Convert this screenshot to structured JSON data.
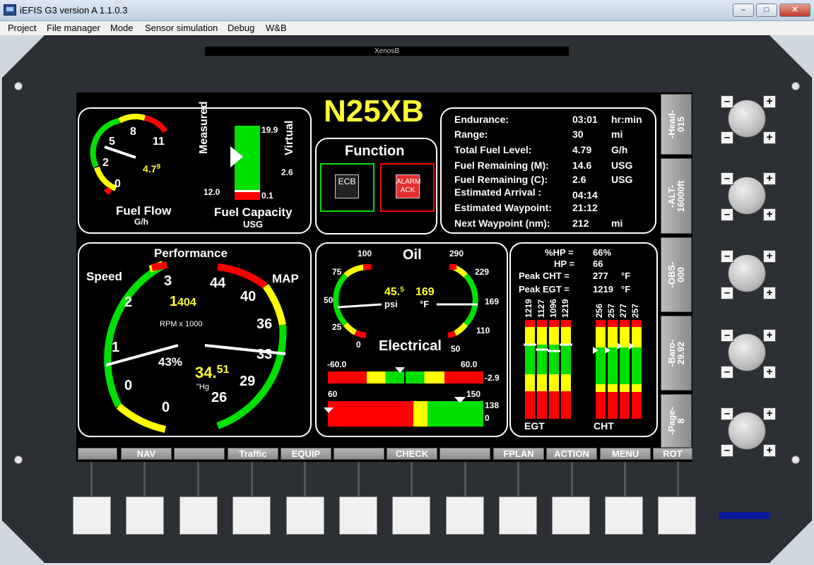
{
  "window": {
    "title": "iEFIS G3 version A 1.1.0.3",
    "minimize": "–",
    "maximize": "□",
    "close": "✕"
  },
  "menu": [
    "Project",
    "File manager",
    "Mode",
    "Sensor simulation",
    "Debug",
    "W&B"
  ],
  "bezel_name": "XenosB",
  "registration": "N25XB",
  "fuel_flow": {
    "title": "Fuel Flow",
    "unit": "G/h",
    "ticks": [
      "0",
      "2",
      "5",
      "8",
      "11"
    ],
    "value_main": "4.7",
    "value_small": "9"
  },
  "fuel_capacity": {
    "title": "Fuel Capacity",
    "unit": "USG",
    "measured_label": "Measured",
    "virtual_label": "Virtual",
    "top": "19.9",
    "mid": "2.6",
    "left_bottom": "12.0",
    "right_bottom": "0.1"
  },
  "function": {
    "title": "Function",
    "ecb": "ECB",
    "alarm": "ALARM ACK"
  },
  "info": [
    {
      "label": "Endurance:",
      "value": "03:01",
      "unit": "hr:min"
    },
    {
      "label": "Range:",
      "value": "30",
      "unit": "mi"
    },
    {
      "label": "Total Fuel Level:",
      "value": "4.79",
      "unit": "G/h"
    },
    {
      "label": "Fuel Remaining (M):",
      "value": "14.6",
      "unit": "USG"
    },
    {
      "label": "Fuel Remaining (C):",
      "value": "2.6",
      "unit": "USG"
    },
    {
      "label": "Estimated Arrival :",
      "value": "04:14",
      "unit": ""
    },
    {
      "label": "Estimated Waypoint:",
      "value": "21:12",
      "unit": ""
    },
    {
      "label": "Next Waypoint (nm):",
      "value": "212",
      "unit": "mi"
    }
  ],
  "performance": {
    "title": "Performance",
    "speed_label": "Speed",
    "map_label": "MAP",
    "rpm_label": "RPM x 1000",
    "rpm_main": "1",
    "rpm_small": "404",
    "percent": "43%",
    "map_main": "34.",
    "map_small": "51",
    "map_unit": "\"Hg",
    "speed_ticks": [
      "0",
      "0",
      "1",
      "2",
      "3"
    ],
    "map_ticks": [
      "26",
      "29",
      "33",
      "36",
      "40",
      "44"
    ]
  },
  "oil": {
    "title": "Oil",
    "press_ticks": [
      "0",
      "25",
      "50",
      "75",
      "100"
    ],
    "press_main": "45.",
    "press_small": "5",
    "press_unit": "psi",
    "temp_value": "169",
    "temp_unit": "°F",
    "temp_ticks": [
      "290",
      "229",
      "169",
      "110",
      "50"
    ]
  },
  "electrical": {
    "title": "Electrical",
    "amp_min": "-60.0",
    "amp_max": "60.0",
    "amp_value": "-2.9",
    "volt_min": "60",
    "volt_max": "150",
    "volt_value": "138",
    "bottom_value": "0"
  },
  "engine": {
    "hp_pct_label": "%HP =",
    "hp_pct": "66%",
    "hp_label": "HP =",
    "hp": "66",
    "peak_cht_label": "Peak CHT =",
    "peak_cht": "277",
    "peak_cht_unit": "°F",
    "peak_egt_label": "Peak EGT =",
    "peak_egt": "1219",
    "peak_egt_unit": "°F",
    "egt_values": [
      "1219",
      "1127",
      "1096",
      "1219"
    ],
    "cht_values": [
      "256",
      "257",
      "277",
      "257"
    ],
    "egt_label": "EGT",
    "cht_label": "CHT"
  },
  "side_buttons": [
    "-Head-\n015",
    "-ALT-\n16000ft",
    "-OBS-\n000",
    "-Baro-\n29.92",
    "-Page-\n8"
  ],
  "softkeys": [
    "",
    "NAV",
    "",
    "Traffic",
    "EQUIP",
    "",
    "CHECK",
    "",
    "FPLAN",
    "ACTION",
    "MENU",
    "ROT"
  ],
  "knob_minus": "–",
  "knob_plus": "+",
  "colors": {
    "green": "#00e000",
    "yellow": "#ffff00",
    "red": "#ff0000",
    "accent": "#ffff33"
  }
}
